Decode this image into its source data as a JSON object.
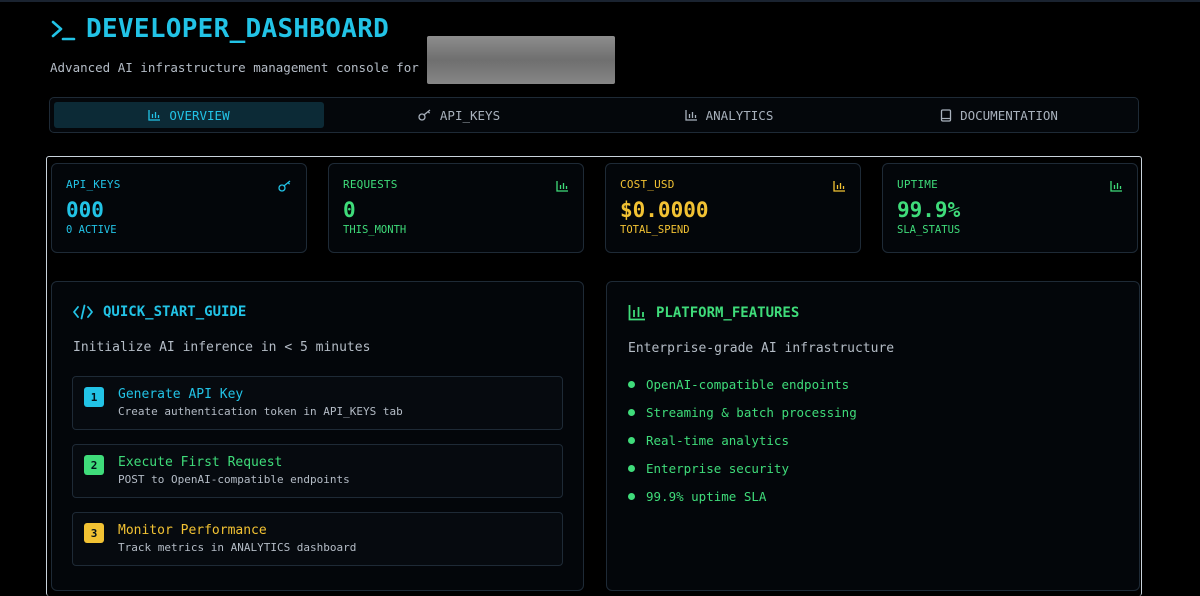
{
  "header": {
    "title": "DEVELOPER_DASHBOARD",
    "subtitle": "Advanced AI infrastructure management console for"
  },
  "tabs": [
    {
      "label": "OVERVIEW",
      "icon": "bar-chart-icon",
      "active": true
    },
    {
      "label": "API_KEYS",
      "icon": "key-icon",
      "active": false
    },
    {
      "label": "ANALYTICS",
      "icon": "bar-chart-icon",
      "active": false
    },
    {
      "label": "DOCUMENTATION",
      "icon": "book-icon",
      "active": false
    }
  ],
  "stats": [
    {
      "label": "API_KEYS",
      "value": "000",
      "sub": "0 ACTIVE",
      "icon": "key-icon",
      "color": "#22c3e6"
    },
    {
      "label": "REQUESTS",
      "value": "0",
      "sub": "THIS_MONTH",
      "icon": "bar-chart-icon",
      "color": "#3fdc7a"
    },
    {
      "label": "COST_USD",
      "value": "$0.0000",
      "sub": "TOTAL_SPEND",
      "icon": "bar-chart-icon",
      "color": "#f2c233"
    },
    {
      "label": "UPTIME",
      "value": "99.9%",
      "sub": "SLA_STATUS",
      "icon": "bar-chart-icon",
      "color": "#3fdc7a"
    }
  ],
  "quick_start": {
    "title": "QUICK_START_GUIDE",
    "description": "Initialize AI inference in < 5 minutes",
    "steps": [
      {
        "num": "1",
        "title": "Generate API Key",
        "desc": "Create authentication token in API_KEYS tab",
        "color": "#22c3e6"
      },
      {
        "num": "2",
        "title": "Execute First Request",
        "desc": "POST to OpenAI-compatible endpoints",
        "color": "#3fdc7a"
      },
      {
        "num": "3",
        "title": "Monitor Performance",
        "desc": "Track metrics in ANALYTICS dashboard",
        "color": "#f2c233"
      }
    ]
  },
  "features": {
    "title": "PLATFORM_FEATURES",
    "description": "Enterprise-grade AI infrastructure",
    "items": [
      "OpenAI-compatible endpoints",
      "Streaming & batch processing",
      "Real-time analytics",
      "Enterprise security",
      "99.9% uptime SLA"
    ]
  },
  "colors": {
    "cyan": "#22c3e6",
    "green": "#3fdc7a",
    "amber": "#f2c233",
    "background": "#000000"
  }
}
